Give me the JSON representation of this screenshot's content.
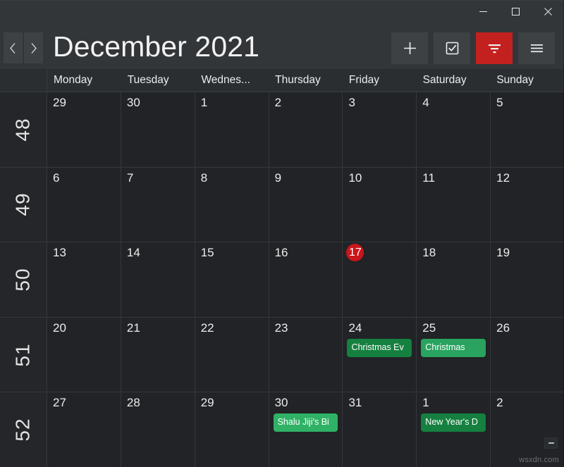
{
  "window": {
    "controls": [
      {
        "name": "minimize",
        "glyph": "minimize-icon"
      },
      {
        "name": "maximize",
        "glyph": "maximize-icon"
      },
      {
        "name": "close",
        "glyph": "close-icon"
      }
    ]
  },
  "header": {
    "title": "December 2021",
    "prev_label": "‹",
    "next_label": "›",
    "prev_icon": "chevron-left-icon",
    "next_icon": "chevron-right-icon",
    "toolbar": [
      {
        "name": "add-event-button",
        "icon": "plus-icon",
        "accent": false
      },
      {
        "name": "tasks-button",
        "icon": "checkbox-icon",
        "accent": false
      },
      {
        "name": "filter-button",
        "icon": "filter-icon",
        "accent": true
      },
      {
        "name": "menu-button",
        "icon": "hamburger-icon",
        "accent": false
      }
    ],
    "accent_color": "#c3211f"
  },
  "calendar": {
    "week_column_header": "",
    "day_headers": [
      "Monday",
      "Tuesday",
      "Wednes...",
      "Thursday",
      "Friday",
      "Saturday",
      "Sunday"
    ],
    "today_color": "#c9151b",
    "weeks": [
      {
        "week_number": "48",
        "days": [
          {
            "num": "29",
            "today": false,
            "events": []
          },
          {
            "num": "30",
            "today": false,
            "events": []
          },
          {
            "num": "1",
            "today": false,
            "events": []
          },
          {
            "num": "2",
            "today": false,
            "events": []
          },
          {
            "num": "3",
            "today": false,
            "events": []
          },
          {
            "num": "4",
            "today": false,
            "events": []
          },
          {
            "num": "5",
            "today": false,
            "events": []
          }
        ]
      },
      {
        "week_number": "49",
        "days": [
          {
            "num": "6",
            "today": false,
            "events": []
          },
          {
            "num": "7",
            "today": false,
            "events": []
          },
          {
            "num": "8",
            "today": false,
            "events": []
          },
          {
            "num": "9",
            "today": false,
            "events": []
          },
          {
            "num": "10",
            "today": false,
            "events": []
          },
          {
            "num": "11",
            "today": false,
            "events": []
          },
          {
            "num": "12",
            "today": false,
            "events": []
          }
        ]
      },
      {
        "week_number": "50",
        "days": [
          {
            "num": "13",
            "today": false,
            "events": []
          },
          {
            "num": "14",
            "today": false,
            "events": []
          },
          {
            "num": "15",
            "today": false,
            "events": []
          },
          {
            "num": "16",
            "today": false,
            "events": []
          },
          {
            "num": "17",
            "today": true,
            "events": []
          },
          {
            "num": "18",
            "today": false,
            "events": []
          },
          {
            "num": "19",
            "today": false,
            "events": []
          }
        ]
      },
      {
        "week_number": "51",
        "days": [
          {
            "num": "20",
            "today": false,
            "events": []
          },
          {
            "num": "21",
            "today": false,
            "events": []
          },
          {
            "num": "22",
            "today": false,
            "events": []
          },
          {
            "num": "23",
            "today": false,
            "events": []
          },
          {
            "num": "24",
            "today": false,
            "events": [
              {
                "title": "Christmas Ev",
                "color": "#15803f"
              }
            ]
          },
          {
            "num": "25",
            "today": false,
            "events": [
              {
                "title": "Christmas",
                "color": "#29a35f"
              }
            ]
          },
          {
            "num": "26",
            "today": false,
            "events": []
          }
        ]
      },
      {
        "week_number": "52",
        "days": [
          {
            "num": "27",
            "today": false,
            "events": []
          },
          {
            "num": "28",
            "today": false,
            "events": []
          },
          {
            "num": "29",
            "today": false,
            "events": []
          },
          {
            "num": "30",
            "today": false,
            "events": [
              {
                "title": "Shalu Jiji's Bi",
                "color": "#2fb265"
              }
            ]
          },
          {
            "num": "31",
            "today": false,
            "events": []
          },
          {
            "num": "1",
            "today": false,
            "events": [
              {
                "title": "New Year's D",
                "color": "#15803f"
              }
            ]
          },
          {
            "num": "2",
            "today": false,
            "events": []
          }
        ]
      }
    ]
  },
  "footer": {
    "resize_button_icon": "minus-icon",
    "watermark": "wsxdn.com"
  }
}
